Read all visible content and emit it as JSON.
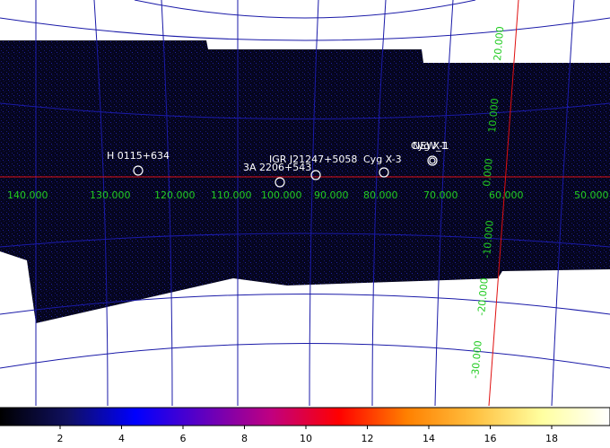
{
  "sky_map": {
    "sources": [
      {
        "name": "H 0115+634"
      },
      {
        "name": "3A 2206+543"
      },
      {
        "name": "IGR J21247+5058"
      },
      {
        "name": "Cyg X-3"
      },
      {
        "name": "Cyg X-1"
      },
      {
        "name": "NEW_1"
      }
    ],
    "lon_labels": [
      "140.000",
      "130.000",
      "120.000",
      "110.000",
      "100.000",
      "90.000",
      "80.000",
      "70.000",
      "60.000",
      "50.000"
    ],
    "lat_labels": [
      "20.000",
      "10.000",
      "0.000",
      "-10.000",
      "-20.000",
      "-30.000"
    ],
    "colors": {
      "background": "#ffffff",
      "image_fill": "#05051e",
      "grid": "#1a1aa8",
      "equator_meridian": "#e01010",
      "axis_labels": "#22cc22",
      "source_labels": "#ffffff"
    }
  },
  "colorbar": {
    "tick_labels": [
      "2",
      "4",
      "6",
      "8",
      "10",
      "12",
      "14",
      "16",
      "18"
    ],
    "gradient": [
      "#000000",
      "#101060",
      "#0000ff",
      "#6000c0",
      "#c00080",
      "#ff0000",
      "#ff8000",
      "#ffc040",
      "#ffffa0",
      "#ffffff"
    ]
  }
}
